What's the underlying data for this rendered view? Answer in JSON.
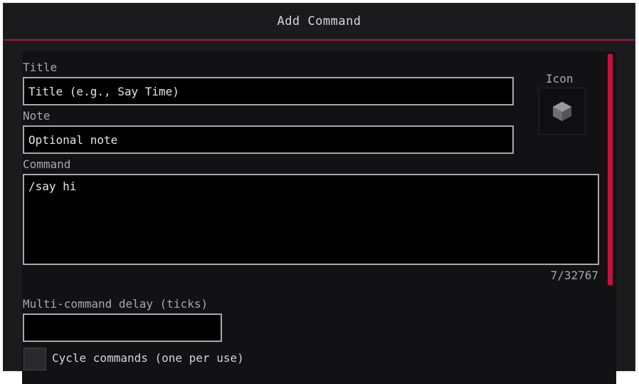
{
  "dialog": {
    "title": "Add Command"
  },
  "form": {
    "title_label": "Title",
    "title_placeholder": "Title (e.g., Say Time)",
    "title_value": "",
    "note_label": "Note",
    "note_placeholder": "Optional note",
    "note_value": "",
    "icon_label": "Icon",
    "icon_name": "stone-block-icon",
    "command_label": "Command",
    "command_value": "/say hi",
    "char_counter": "7/32767",
    "delay_label": "Multi-command delay (ticks)",
    "delay_value": "",
    "cycle_label": "Cycle commands (one per use)",
    "cycle_checked": false
  },
  "colors": {
    "accent": "#c8103f",
    "background": "#1b1b1e",
    "panel": "#121214",
    "field_border": "#a9a9a9"
  }
}
